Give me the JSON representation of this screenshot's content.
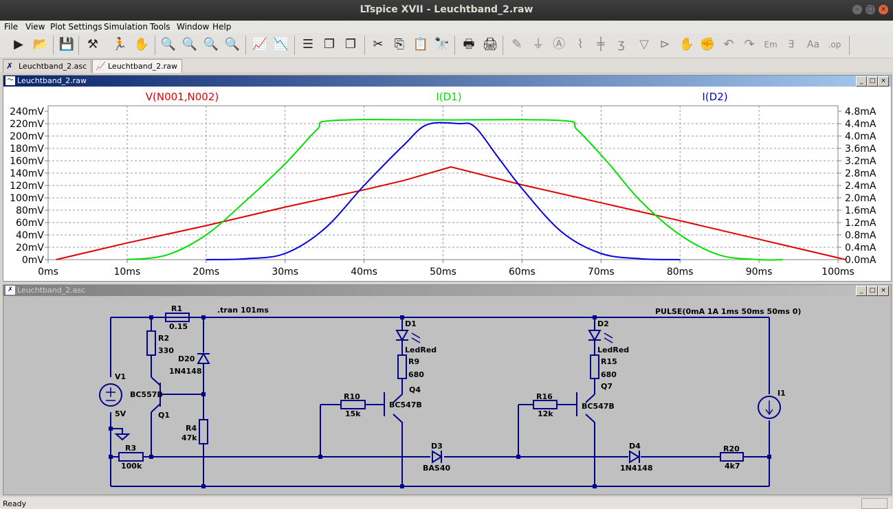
{
  "window": {
    "title": "LTspice XVII - Leuchtband_2.raw"
  },
  "menu": [
    "File",
    "View",
    "Plot Settings",
    "Simulation",
    "Tools",
    "Window",
    "Help"
  ],
  "tabs": [
    {
      "label": "Leuchtband_2.asc",
      "active": false
    },
    {
      "label": "Leuchtband_2.raw",
      "active": true
    }
  ],
  "waveform_window": {
    "title": "Leuchtband_2.raw"
  },
  "schematic_window": {
    "title": "Leuchtband_2.asc"
  },
  "chart_data": {
    "type": "line",
    "x_tick_labels": [
      "0ms",
      "10ms",
      "20ms",
      "30ms",
      "40ms",
      "50ms",
      "60ms",
      "70ms",
      "80ms",
      "90ms",
      "100ms"
    ],
    "xlim": [
      0,
      100
    ],
    "y_left_tick_labels": [
      "240mV",
      "220mV",
      "200mV",
      "180mV",
      "160mV",
      "140mV",
      "120mV",
      "100mV",
      "80mV",
      "60mV",
      "40mV",
      "20mV",
      "0mV"
    ],
    "ylim_left": [
      0,
      240
    ],
    "y_right_tick_labels": [
      "4.8mA",
      "4.4mA",
      "4.0mA",
      "3.6mA",
      "3.2mA",
      "2.8mA",
      "2.4mA",
      "2.0mA",
      "1.6mA",
      "1.2mA",
      "0.8mA",
      "0.4mA",
      "0.0mA"
    ],
    "ylim_right": [
      0,
      4.8
    ],
    "grid": true,
    "series": [
      {
        "name": "V(N001,N002)",
        "axis": "left",
        "color": "#e00000",
        "x": [
          1,
          10,
          20,
          30,
          40,
          45,
          51,
          60,
          70,
          80,
          90,
          101
        ],
        "y": [
          0,
          27,
          55,
          85,
          113,
          128,
          150,
          121,
          92,
          63,
          33,
          0
        ]
      },
      {
        "name": "I(D1)",
        "axis": "right",
        "color": "#00e000",
        "x": [
          10,
          15,
          20,
          25,
          30,
          34,
          36,
          50,
          65,
          67,
          71,
          75,
          80,
          85,
          90,
          93
        ],
        "y": [
          0,
          0.15,
          0.8,
          1.9,
          3.1,
          4.2,
          4.5,
          4.52,
          4.5,
          4.2,
          3.1,
          1.9,
          0.8,
          0.15,
          0,
          0
        ]
      },
      {
        "name": "I(D2)",
        "axis": "right",
        "color": "#0000e0",
        "x": [
          20,
          25,
          30,
          35,
          40,
          45,
          48,
          52,
          54,
          57,
          60,
          65,
          70,
          75,
          80
        ],
        "y": [
          0,
          0.03,
          0.2,
          1.0,
          2.4,
          3.7,
          4.37,
          4.4,
          4.3,
          3.3,
          2.3,
          0.9,
          0.2,
          0.03,
          0
        ]
      }
    ]
  },
  "schematic": {
    "directives": [
      ".tran 101ms",
      "PULSE(0mA 1A 1ms 50ms 50ms 0)"
    ],
    "labels": {
      "r1": "R1",
      "r1v": "0.15",
      "r2": "R2",
      "r2v": "330",
      "d20": "D20",
      "d20v": "1N4148",
      "v1": "V1",
      "v1v": "5V",
      "q1m": "BC557B",
      "q1": "Q1",
      "r4": "R4",
      "r4v": "47k",
      "r3": "R3",
      "r3v": "100k",
      "d1": "D1",
      "d1v": "LedRed",
      "r9": "R9",
      "r9v": "680",
      "q4": "Q4",
      "q4m": "BC547B",
      "r10": "R10",
      "r10v": "15k",
      "d3": "D3",
      "d3v": "BAS40",
      "d2": "D2",
      "d2v": "LedRed",
      "r15": "R15",
      "r15v": "680",
      "q7": "Q7",
      "q7m": "BC547B",
      "r16": "R16",
      "r16v": "12k",
      "d4": "D4",
      "d4v": "1N4148",
      "r20": "R20",
      "r20v": "4k7",
      "i1": "I1"
    }
  },
  "status": {
    "text": "Ready"
  },
  "colors": {
    "wire": "#00008a",
    "schematic_bg": "#c0c0c0"
  }
}
